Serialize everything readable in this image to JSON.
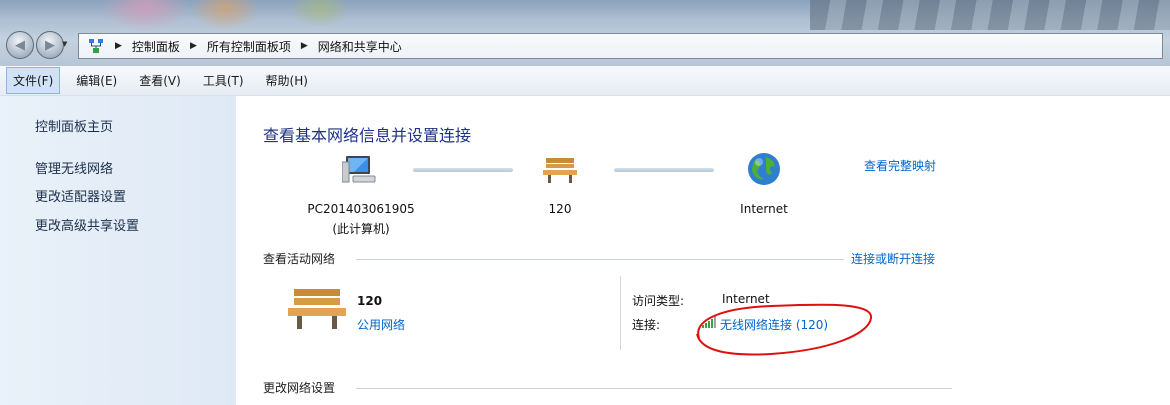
{
  "address": {
    "crumbs": [
      "控制面板",
      "所有控制面板项",
      "网络和共享中心"
    ]
  },
  "menu": {
    "items": [
      "文件(F)",
      "编辑(E)",
      "查看(V)",
      "工具(T)",
      "帮助(H)"
    ]
  },
  "sidebar": {
    "items": [
      "控制面板主页",
      "管理无线网络",
      "更改适配器设置",
      "更改高级共享设置"
    ]
  },
  "main": {
    "title": "查看基本网络信息并设置连接",
    "map_link": "查看完整映射",
    "nodes": {
      "computer_name": "PC201403061905",
      "computer_sub": "(此计算机)",
      "network_name": "120",
      "internet": "Internet"
    },
    "active": {
      "section_title": "查看活动网络",
      "section_link": "连接或断开连接",
      "network_name": "120",
      "network_type": "公用网络",
      "access_label": "访问类型:",
      "access_value": "Internet",
      "conn_label": "连接:",
      "conn_value": "无线网络连接 (120)"
    },
    "change": {
      "section_title": "更改网络设置"
    }
  },
  "colors": {
    "link": "#0066cc",
    "title": "#1e3287",
    "annotation": "#e01010"
  }
}
